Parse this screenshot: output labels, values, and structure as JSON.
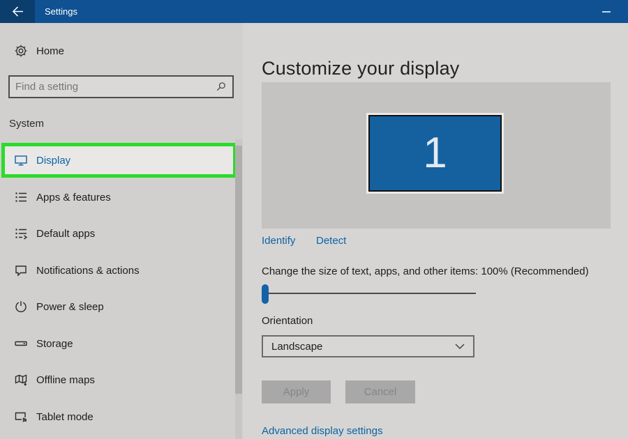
{
  "titlebar": {
    "title": "Settings",
    "back_icon": "arrow-left",
    "minimize_icon": "minimize-dash"
  },
  "sidebar": {
    "home_label": "Home",
    "search_placeholder": "Find a setting",
    "search_icon": "magnifier",
    "section_label": "System",
    "items": [
      {
        "label": "Display",
        "icon": "monitor-icon",
        "selected": true,
        "annotated": "green-highlight-box"
      },
      {
        "label": "Apps & features",
        "icon": "apps-list-icon"
      },
      {
        "label": "Default apps",
        "icon": "default-apps-icon"
      },
      {
        "label": "Notifications & actions",
        "icon": "chat-bubble-icon"
      },
      {
        "label": "Power & sleep",
        "icon": "power-icon"
      },
      {
        "label": "Storage",
        "icon": "storage-drive-icon"
      },
      {
        "label": "Offline maps",
        "icon": "map-icon"
      },
      {
        "label": "Tablet mode",
        "icon": "tablet-touch-icon"
      }
    ]
  },
  "main": {
    "title": "Customize your display",
    "monitor_number": "1",
    "identify_link": "Identify",
    "detect_link": "Detect",
    "scale_text": "Change the size of text, apps, and other items: 100% (Recommended)",
    "orientation_label": "Orientation",
    "orientation_value": "Landscape",
    "apply_label": "Apply",
    "cancel_label": "Cancel",
    "advanced_link": "Advanced display settings",
    "slider_position": "minimum"
  },
  "colors": {
    "titlebar_blue": "#0f5192",
    "back_button_blue": "#0b3d6d",
    "accent_link_blue": "#0d63a5",
    "monitor_blue": "#15619f",
    "slider_thumb_blue": "#1463a8",
    "annotation_green": "#2bdb2b",
    "disabled_button_gray": "#a8a8a8",
    "sidebar_gray": "#d2d0ce",
    "main_gray": "#d7d5d3",
    "preview_gray": "#c4c3c1"
  }
}
